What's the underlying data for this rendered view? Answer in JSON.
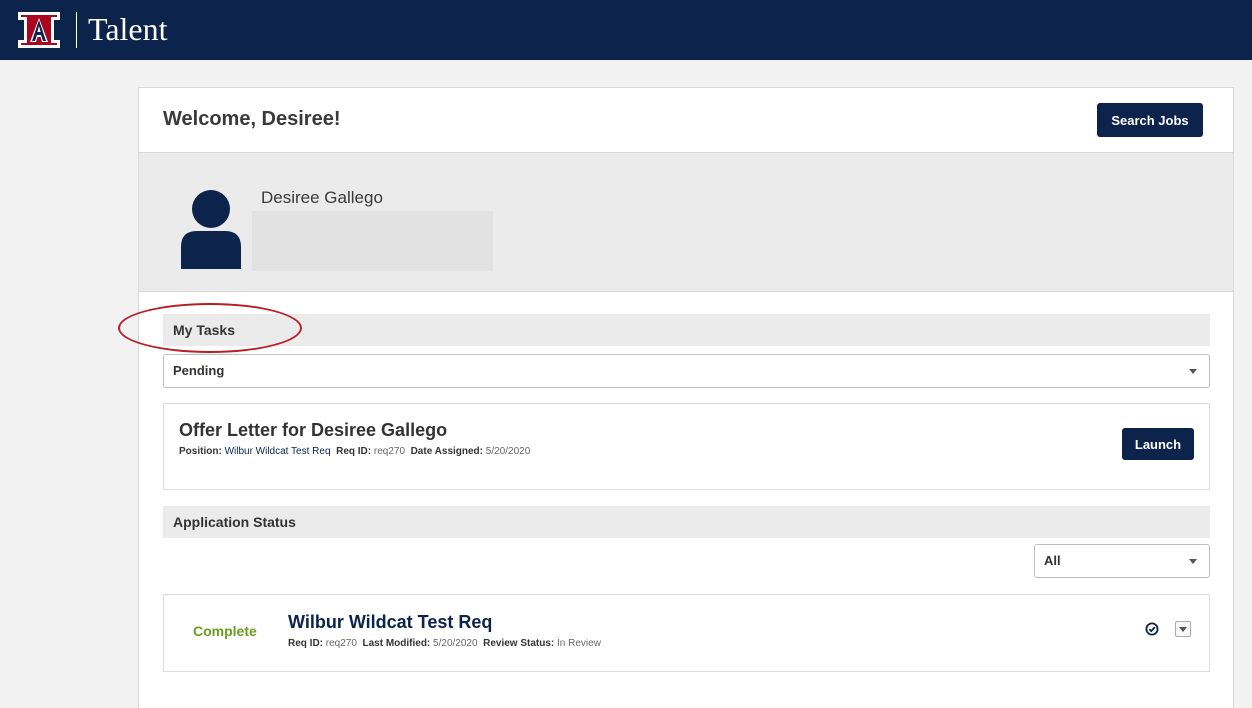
{
  "header": {
    "app_title": "Talent",
    "logo": "university-of-arizona-logo",
    "brand_color": "#0c234b",
    "accent_color": "#ab0520"
  },
  "welcome": {
    "title": "Welcome, Desiree!",
    "search_jobs_label": "Search Jobs"
  },
  "profile": {
    "name": "Desiree Gallego",
    "avatar_icon": "user-silhouette-icon"
  },
  "my_tasks": {
    "section_title": "My Tasks",
    "filter_value": "Pending",
    "task": {
      "title": "Offer Letter for Desiree Gallego",
      "position_label": "Position:",
      "position_value": "Wilbur Wildcat Test Req",
      "req_id_label": "Req ID:",
      "req_id_value": "req270",
      "date_assigned_label": "Date Assigned:",
      "date_assigned_value": "5/20/2020",
      "launch_label": "Launch"
    }
  },
  "application_status": {
    "section_title": "Application Status",
    "filter_value": "All",
    "application": {
      "status": "Complete",
      "status_color": "#6a9d1e",
      "title": "Wilbur Wildcat Test Req",
      "req_id_label": "Req ID:",
      "req_id_value": "req270",
      "last_modified_label": "Last Modified:",
      "last_modified_value": "5/20/2020",
      "review_status_label": "Review Status:",
      "review_status_value": "In Review"
    }
  },
  "annotation": {
    "highlight_color": "#b52025"
  }
}
